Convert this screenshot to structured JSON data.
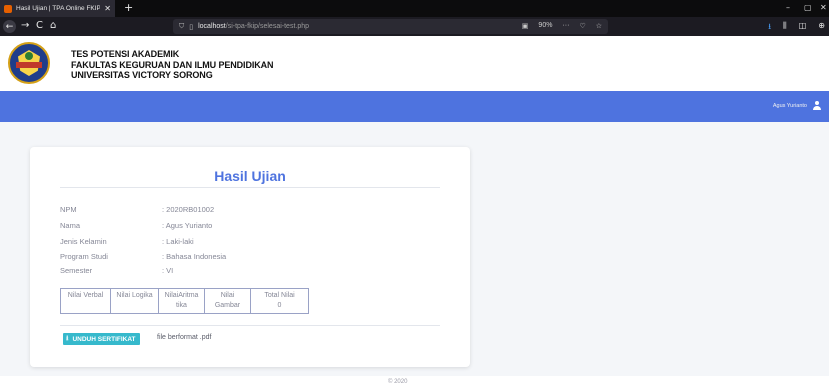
{
  "browser": {
    "tab_title": "Hasil Ujian | TPA Online FKIP UVS",
    "tab_close": "✕",
    "new_tab": "+",
    "back": "←",
    "forward": "→",
    "reload": "C",
    "home": "⌂",
    "url_host": "localhost",
    "url_path": "/si-tpa-fkip/selesai-test.php",
    "zoom": "90%",
    "minimize": "–",
    "maximize": "▢",
    "close": "✕",
    "more": "···",
    "bookmark_star": "☆",
    "pocket": "♡",
    "download": "⭳",
    "library": "⫼",
    "sidebar": "◫",
    "account": "⊕"
  },
  "header": {
    "line1": "TES POTENSI AKADEMIK",
    "line2": "FAKULTAS KEGURUAN DAN ILMU PENDIDIKAN",
    "line3": "UNIVERSITAS VICTORY SORONG"
  },
  "user": {
    "name": "Agus Yurianto"
  },
  "card": {
    "title": "Hasil Ujian",
    "info": [
      {
        "label": "NPM",
        "value": ": 2020RB01002"
      },
      {
        "label": "Nama",
        "value": ": Agus Yurianto"
      },
      {
        "label": "Jenis Kelamin",
        "value": ": Laki-laki"
      },
      {
        "label": "Program Studi",
        "value": ": Bahasa Indonesia"
      },
      {
        "label": "Semester",
        "value": ": VI"
      }
    ],
    "scores": [
      {
        "label": "Nilai Verbal",
        "value": ""
      },
      {
        "label": "Nilai Logika",
        "value": ""
      },
      {
        "label": "NilaiAritma tika",
        "value": ""
      },
      {
        "label": "Nilai Gambar",
        "value": ""
      },
      {
        "label": "Total Nilai",
        "value": "0"
      }
    ],
    "download_label": "UNDUH SERTIFIKAT",
    "download_note": "file berformat .pdf"
  },
  "footer": {
    "copyright": "© 2020"
  },
  "colors": {
    "primary": "#4e73df",
    "button": "#36b9cc",
    "text_muted": "#858796"
  }
}
